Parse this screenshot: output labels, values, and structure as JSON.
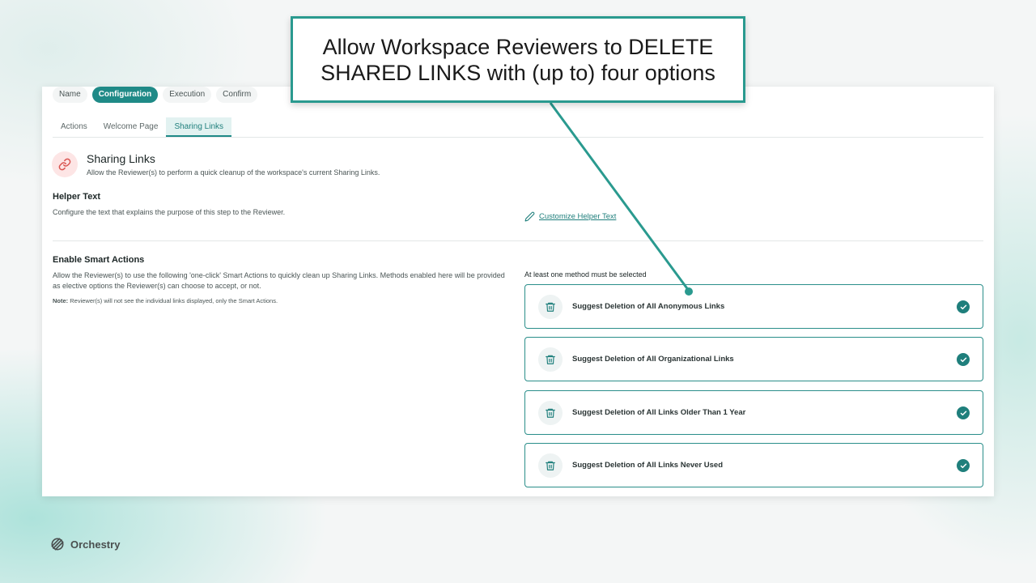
{
  "stepper": {
    "steps": [
      {
        "label": "Name",
        "active": false
      },
      {
        "label": "Configuration",
        "active": true
      },
      {
        "label": "Execution",
        "active": false
      },
      {
        "label": "Confirm",
        "active": false
      }
    ]
  },
  "tabs": [
    {
      "label": "Actions",
      "active": false
    },
    {
      "label": "Welcome Page",
      "active": false
    },
    {
      "label": "Sharing Links",
      "active": true
    }
  ],
  "section": {
    "icon": "link-icon",
    "title": "Sharing Links",
    "description": "Allow the Reviewer(s) to perform a quick cleanup of the workspace's current Sharing Links."
  },
  "helper": {
    "title": "Helper Text",
    "description": "Configure the text that explains the purpose of this step to the Reviewer.",
    "customize_icon": "pencil-icon",
    "customize_link": "Customize Helper Text"
  },
  "smart_actions": {
    "title": "Enable Smart Actions",
    "description": "Allow the Reviewer(s) to use the following 'one-click' Smart Actions to quickly clean up Sharing Links. Methods enabled here will be provided as elective options the Reviewer(s) can choose to accept, or not.",
    "note_label": "Note:",
    "note_text": " Reviewer(s) will not see the individual links displayed, only the Smart Actions.",
    "method_requirement": "At least one method must be selected",
    "options": [
      {
        "label": "Suggest Deletion of All Anonymous Links",
        "checked": true
      },
      {
        "label": "Suggest Deletion of All Organizational Links",
        "checked": true
      },
      {
        "label": "Suggest Deletion of All Links Older Than 1 Year",
        "checked": true
      },
      {
        "label": "Suggest Deletion of All Links Never Used",
        "checked": true
      }
    ]
  },
  "callout": {
    "text": "Allow Workspace Reviewers to DELETE\nSHARED LINKS with (up to) four options"
  },
  "brand": {
    "name": "Orchestry",
    "icon": "orchestry-logo-icon"
  },
  "colors": {
    "accent": "#1f8a87",
    "callout_border": "#2a9a8f",
    "link_icon_bg": "#fde5e5",
    "link_icon": "#d9534f"
  }
}
